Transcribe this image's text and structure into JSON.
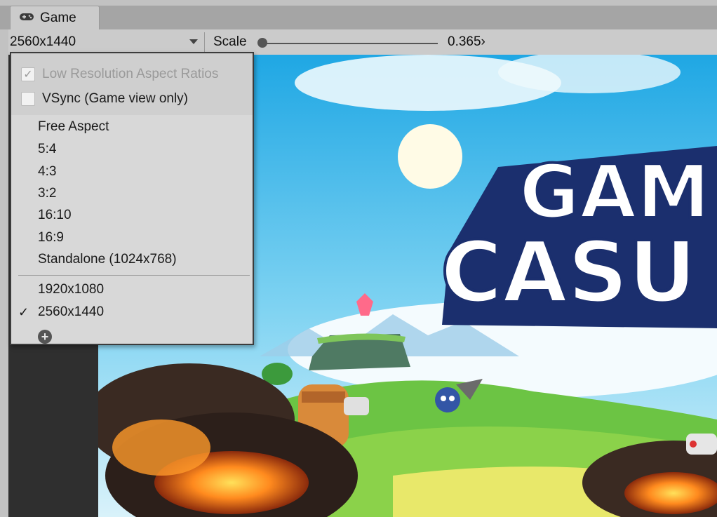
{
  "tab": {
    "icon": "gamepad-icon",
    "label": "Game"
  },
  "toolbar": {
    "resolution": "2560x1440",
    "scale_label": "Scale",
    "scale_value": "0.365›"
  },
  "menu": {
    "options": [
      {
        "label": "Low Resolution Aspect Ratios",
        "checked": true,
        "disabled": true
      },
      {
        "label": "VSync (Game view only)",
        "checked": false,
        "disabled": false
      }
    ],
    "aspects": [
      "Free Aspect",
      "5:4",
      "4:3",
      "3:2",
      "16:10",
      "16:9",
      "Standalone (1024x768)"
    ],
    "custom": [
      "1920x1080",
      "2560x1440"
    ],
    "selected": "2560x1440",
    "add_icon": "plus-circle-icon"
  },
  "game_view": {
    "title_top": "GAM",
    "title_bottom": "CASU"
  },
  "colors": {
    "sky": "#38b6ea",
    "title_fill": "#ffffff",
    "title_outline": "#1b2f6e"
  }
}
